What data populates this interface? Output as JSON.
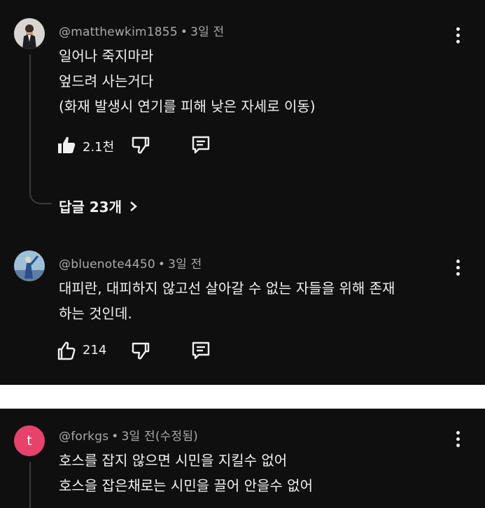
{
  "comments": [
    {
      "username": "@matthewkim1855",
      "time": "3일 전",
      "edited": "",
      "lines": [
        "일어나 죽지마라",
        "엎드려 사는거다",
        "(화재 발생시 연기를 피해 낮은 자세로 이동)"
      ],
      "likes": "2.1천",
      "liked": true,
      "replies_label": "답글 23개",
      "avatar": "person-in-suit-avatar"
    },
    {
      "username": "@bluenote4450",
      "time": "3일 전",
      "edited": "",
      "lines": [
        "대피란, 대피하지 않고선 살아갈 수 없는 자들을 위해 존재",
        "하는 것인데."
      ],
      "likes": "214",
      "liked": false,
      "avatar": "blue-figure-avatar"
    },
    {
      "username": "@forkgs",
      "time": "3일 전",
      "edited": "(수정됨)",
      "lines": [
        "호스를 잡지 않으면 시민을 지킬수 없어",
        "호스을 잡은채로는 시민을 끌어 안을수 없어"
      ],
      "avatar_letter": "t",
      "avatar_color": "#e8426a"
    }
  ],
  "icons": {
    "like": "thumbs-up-icon",
    "dislike": "thumbs-down-icon",
    "reply": "comment-reply-icon",
    "more": "more-vertical-icon",
    "chevron": "chevron-right-icon"
  },
  "colors": {
    "background": "#0f0f0f",
    "text": "#f1f1f1",
    "meta": "#aaaaaa",
    "divider": "#ffffff"
  }
}
